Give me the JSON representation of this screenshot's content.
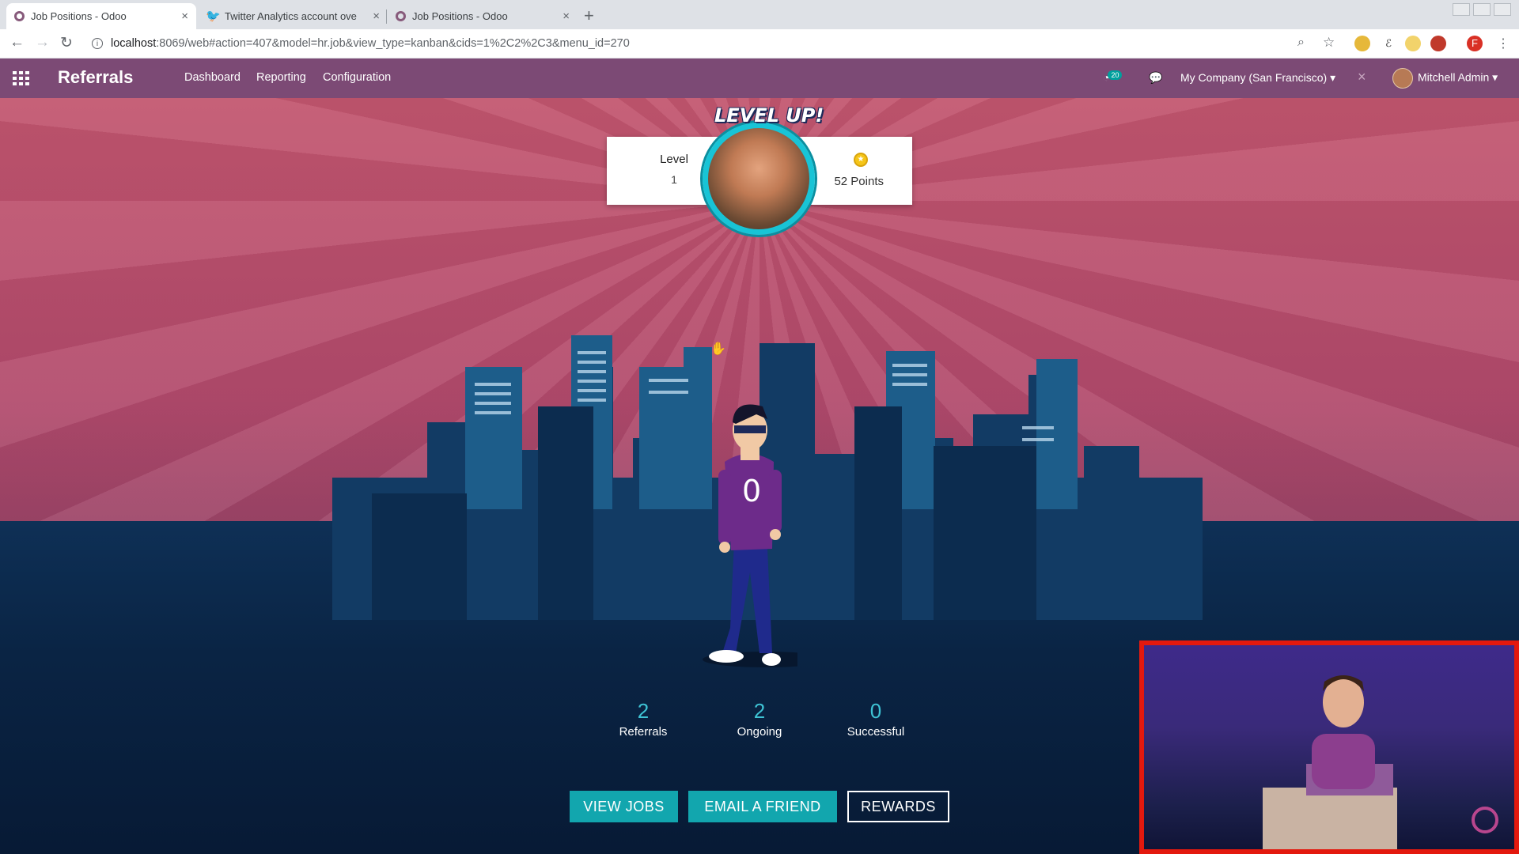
{
  "browser": {
    "tabs": [
      {
        "title": "Job Positions - Odoo",
        "favicon": "odoo-icon",
        "active": true
      },
      {
        "title": "Twitter Analytics account ove",
        "favicon": "twitter-icon",
        "active": false
      },
      {
        "title": "Job Positions - Odoo",
        "favicon": "odoo-icon",
        "active": false
      }
    ],
    "close_glyph": "×",
    "new_tab_glyph": "+",
    "url_host": "localhost",
    "url_rest": ":8069/web#action=407&model=hr.job&view_type=kanban&cids=1%2C2%2C3&menu_id=270"
  },
  "app": {
    "title": "Referrals",
    "menu": [
      "Dashboard",
      "Reporting",
      "Configuration"
    ],
    "activity_count": "20",
    "company": "My Company (San Francisco)",
    "user": "Mitchell Admin",
    "accent_color": "#7c4a75"
  },
  "profile": {
    "level_label": "Level",
    "level_value": "1",
    "level_up_text": "LEVEL UP!",
    "points_text": "52 Points"
  },
  "stats": [
    {
      "value": "2",
      "label": "Referrals"
    },
    {
      "value": "2",
      "label": "Ongoing"
    },
    {
      "value": "0",
      "label": "Successful"
    }
  ],
  "actions": {
    "view_jobs": "VIEW JOBS",
    "email_friend": "EMAIL A FRIEND",
    "rewards": "REWARDS"
  },
  "colors": {
    "button_teal": "#12a6ae",
    "stat_number": "#3ec3d4",
    "pip_border": "#e3190e"
  }
}
